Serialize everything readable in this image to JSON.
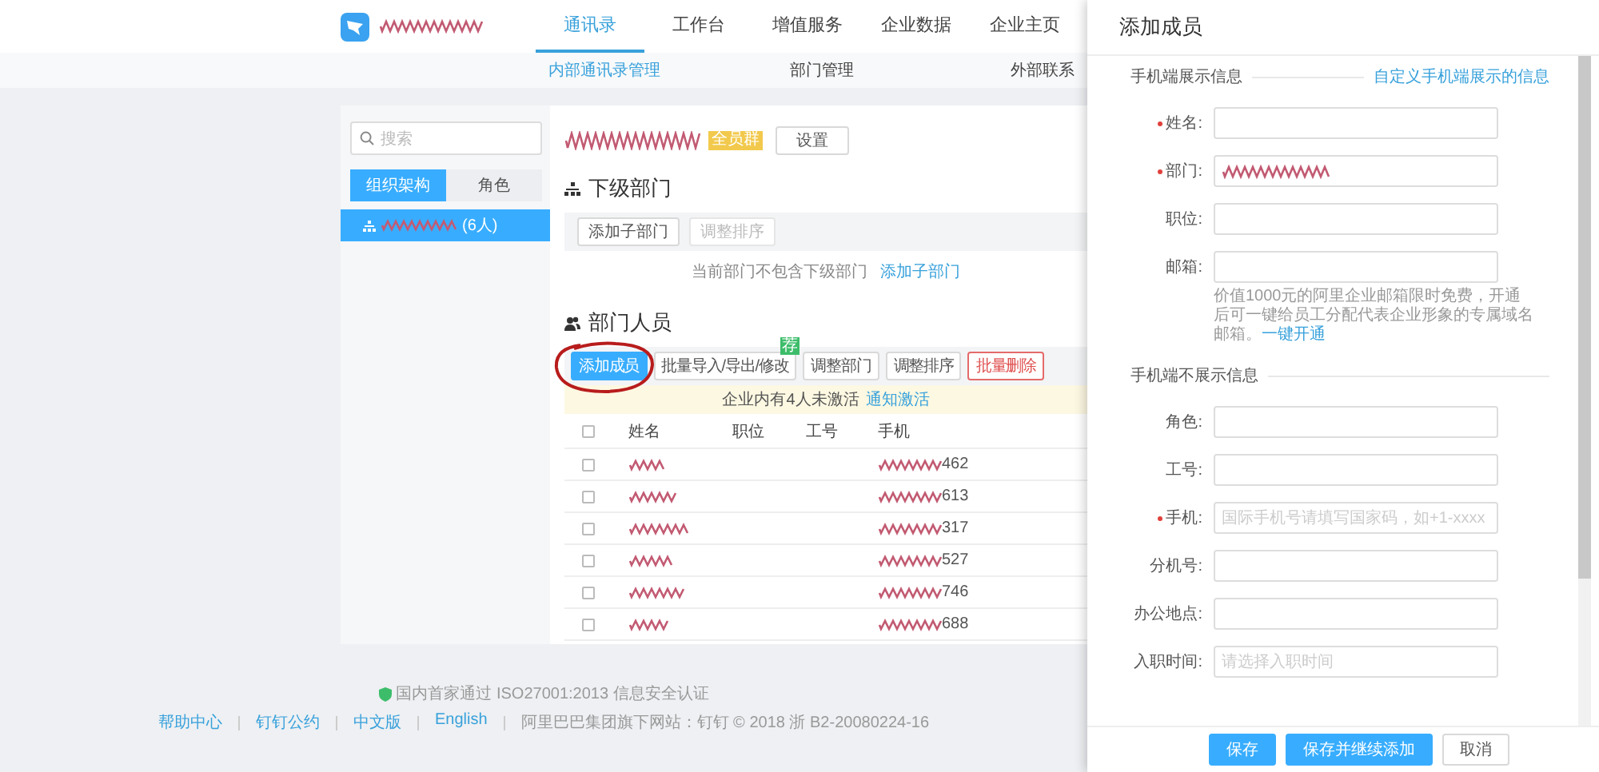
{
  "top_nav": {
    "tabs": [
      {
        "label": "通讯录",
        "selected": true
      },
      {
        "label": "工作台",
        "selected": false
      },
      {
        "label": "增值服务",
        "selected": false
      },
      {
        "label": "企业数据",
        "selected": false
      },
      {
        "label": "企业主页",
        "selected": false
      }
    ]
  },
  "sub_nav": [
    {
      "label": "内部通讯录管理",
      "selected": true
    },
    {
      "label": "部门管理",
      "selected": false
    },
    {
      "label": "外部联系",
      "selected": false
    }
  ],
  "sidebar": {
    "search": {
      "placeholder": "搜索"
    },
    "tabs": [
      {
        "label": "组织架构",
        "selected": true
      },
      {
        "label": "角色",
        "selected": false
      }
    ],
    "tree": [
      {
        "label": "(6人)",
        "selected": true
      }
    ]
  },
  "department": {
    "badge": "全员群",
    "settings_button": "设置",
    "sub_heading": "下级部门",
    "sub_buttons": [
      {
        "label": "添加子部门",
        "disabled": false
      },
      {
        "label": "调整排序",
        "disabled": true
      }
    ],
    "empty_text": "当前部门不包含下级部门",
    "empty_link": "添加子部门",
    "members_heading": "部门人员",
    "member_buttons": [
      {
        "label": "添加成员",
        "kind": "primary",
        "circled": true
      },
      {
        "label": "批量导入/导出/修改",
        "kind": "default",
        "badge": "荐",
        "circled": false
      },
      {
        "label": "调整部门",
        "kind": "default",
        "circled": false
      },
      {
        "label": "调整排序",
        "kind": "default",
        "circled": false
      },
      {
        "label": "批量删除",
        "kind": "danger",
        "circled": false
      }
    ],
    "notice": "企业内有4人未激活",
    "notice_link": "通知激活",
    "table": {
      "select_all_checked": false,
      "columns": [
        "姓名",
        "职位",
        "工号",
        "手机"
      ],
      "rows": [
        {
          "checked": false,
          "phone": "462"
        },
        {
          "checked": false,
          "phone": "613"
        },
        {
          "checked": false,
          "phone": "317"
        },
        {
          "checked": false,
          "phone": "527"
        },
        {
          "checked": false,
          "phone": "746"
        },
        {
          "checked": false,
          "phone": "688"
        }
      ]
    }
  },
  "footer": {
    "certification": "国内首家通过 ISO27001:2013 信息安全认证",
    "links": [
      "帮助中心",
      "钉钉公约",
      "中文版",
      "English"
    ],
    "copyright": "阿里巴巴集团旗下网站：钉钉 © 2018 浙 B2-20080224-16"
  },
  "drawer": {
    "title": "添加成员",
    "sections": [
      {
        "heading": "手机端展示信息",
        "link": "自定义手机端展示的信息",
        "fields": [
          {
            "label": "姓名:",
            "required": true,
            "redacted": false
          },
          {
            "label": "部门:",
            "required": true,
            "redacted": true
          },
          {
            "label": "职位:",
            "required": false,
            "redacted": false
          },
          {
            "label": "邮箱:",
            "required": false,
            "redacted": false,
            "help": "价值1000元的阿里企业邮箱限时免费，开通后可一键给员工分配代表企业形象的专属域名邮箱。",
            "help_link": "一键开通"
          }
        ]
      },
      {
        "heading": "手机端不展示信息",
        "fields": [
          {
            "label": "角色:",
            "required": false,
            "redacted": false
          },
          {
            "label": "工号:",
            "required": false,
            "redacted": false
          },
          {
            "label": "手机:",
            "required": true,
            "redacted": false,
            "placeholder": "国际手机号请填写国家码，如+1-xxxx"
          },
          {
            "label": "分机号:",
            "required": false,
            "redacted": false
          },
          {
            "label": "办公地点:",
            "required": false,
            "redacted": false
          },
          {
            "label": "入职时间:",
            "required": false,
            "redacted": false,
            "placeholder": "请选择入职时间"
          }
        ]
      }
    ],
    "buttons": [
      {
        "label": "保存",
        "kind": "primary"
      },
      {
        "label": "保存并继续添加",
        "kind": "primary"
      },
      {
        "label": "取消",
        "kind": "default"
      }
    ]
  }
}
